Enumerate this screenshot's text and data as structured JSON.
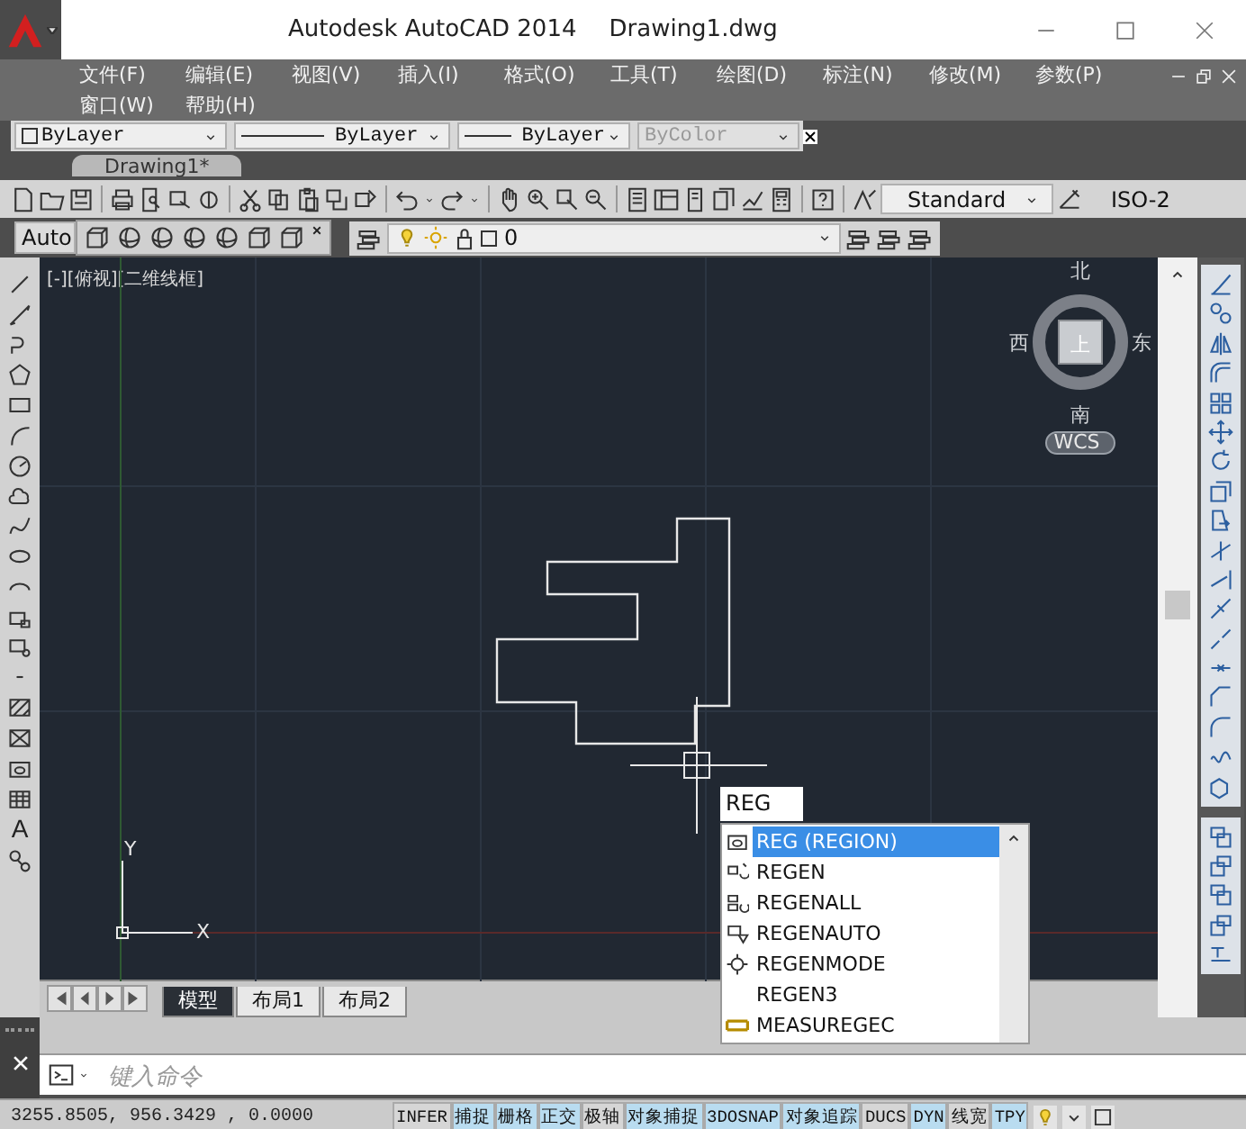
{
  "title_bar": {
    "app_title": "Autodesk AutoCAD 2014",
    "file_name": "Drawing1.dwg"
  },
  "menu_bar": [
    {
      "label": "文件(F)"
    },
    {
      "label": "编辑(E)"
    },
    {
      "label": "视图(V)"
    },
    {
      "label": "插入(I)"
    },
    {
      "label": "格式(O)"
    },
    {
      "label": "工具(T)"
    },
    {
      "label": "绘图(D)"
    },
    {
      "label": "标注(N)"
    },
    {
      "label": "修改(M)"
    },
    {
      "label": "参数(P)"
    },
    {
      "label": "窗口(W)"
    },
    {
      "label": "帮助(H)"
    }
  ],
  "properties_toolbar": {
    "color_control": "ByLayer",
    "linetype": "ByLayer",
    "lineweight": "ByLayer",
    "plot_style": "ByColor",
    "plot_style_disabled": true
  },
  "file_tabs": [
    {
      "label": "Drawing1*",
      "selected": true
    }
  ],
  "standard_toolbar": {
    "text_style": "Standard",
    "dimension_style": "ISO-2"
  },
  "workspace_toolbar": {
    "workspace": "Auto"
  },
  "layers_toolbar": {
    "current_layer": "0"
  },
  "viewport": {
    "label": "[-][俯视][二维线框]",
    "viewcube": {
      "north": "北",
      "south": "南",
      "east": "东",
      "west": "西",
      "face": "上",
      "ucs_menu": "WCS"
    },
    "ucs": {
      "x": "X",
      "y": "Y"
    }
  },
  "draw_toolbar": {
    "text_tool_glyph": "A"
  },
  "autocomplete": {
    "input": "REG",
    "items": [
      {
        "label": "REG (REGION)",
        "selected": true,
        "kind": "region"
      },
      {
        "label": "REGEN",
        "selected": false,
        "kind": "regen"
      },
      {
        "label": "REGENALL",
        "selected": false,
        "kind": "regenall"
      },
      {
        "label": "REGENAUTO",
        "selected": false,
        "kind": "regenauto"
      },
      {
        "label": "REGENMODE",
        "selected": false,
        "kind": "setting"
      },
      {
        "label": "REGEN3",
        "selected": false,
        "kind": "none"
      },
      {
        "label": "MEASUREGEC",
        "selected": false,
        "kind": "measure"
      }
    ]
  },
  "layout_tabs": [
    {
      "label": "模型",
      "selected": true
    },
    {
      "label": "布局1",
      "selected": false
    },
    {
      "label": "布局2",
      "selected": false
    }
  ],
  "command_line": {
    "placeholder": "键入命令"
  },
  "status_bar": {
    "coordinates": "3255.8505, 956.3429 , 0.0000",
    "toggles": [
      {
        "label": "INFER",
        "on": false
      },
      {
        "label": "捕捉",
        "on": true
      },
      {
        "label": "栅格",
        "on": true
      },
      {
        "label": "正交",
        "on": true
      },
      {
        "label": "极轴",
        "on": false
      },
      {
        "label": "对象捕捉",
        "on": true
      },
      {
        "label": "3DOSNAP",
        "on": true
      },
      {
        "label": "对象追踪",
        "on": true
      },
      {
        "label": "DUCS",
        "on": false
      },
      {
        "label": "DYN",
        "on": true
      },
      {
        "label": "线宽",
        "on": false
      },
      {
        "label": "TPY",
        "on": true
      }
    ]
  }
}
